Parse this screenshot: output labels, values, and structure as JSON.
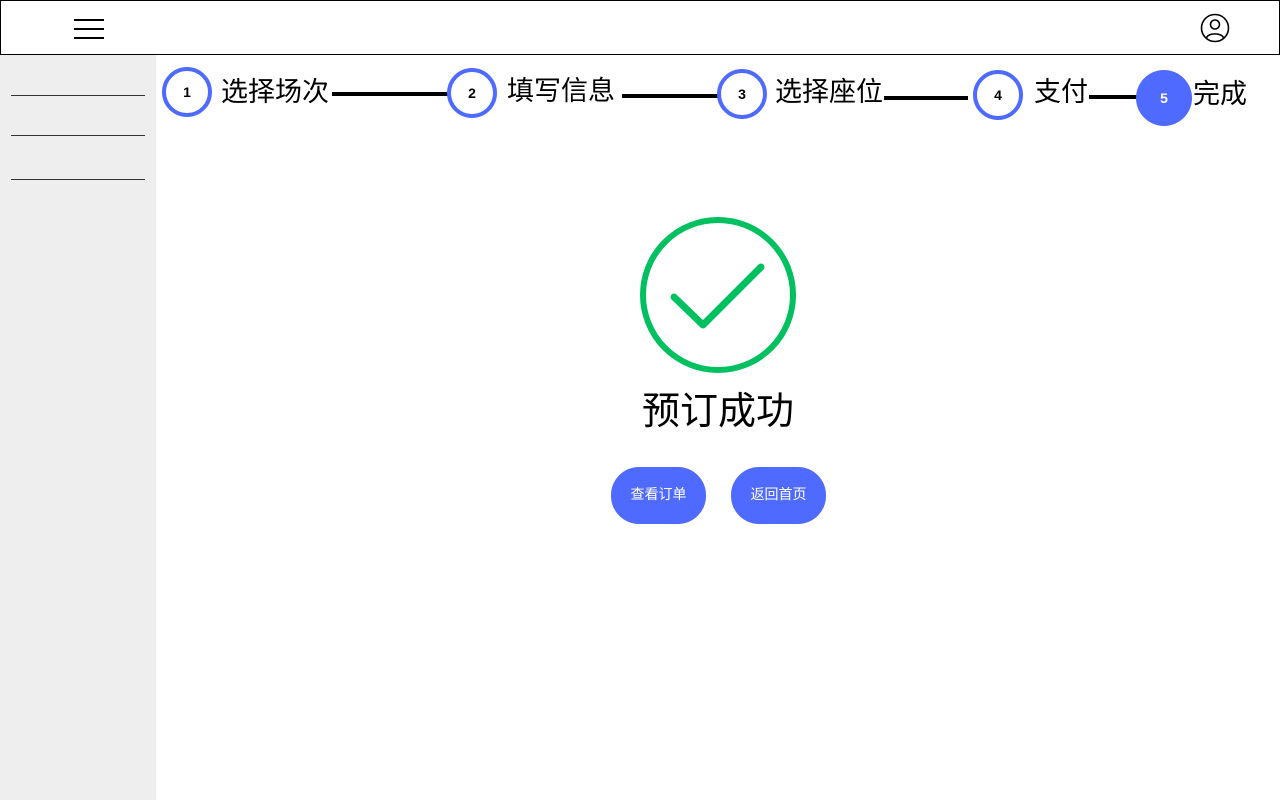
{
  "header": {
    "menu_icon": "hamburger-menu-icon",
    "user_icon": "user-avatar-icon"
  },
  "steps": [
    {
      "number": "1",
      "label": "选择场次",
      "state": "done"
    },
    {
      "number": "2",
      "label": "填写信息",
      "state": "done"
    },
    {
      "number": "3",
      "label": "选择座位",
      "state": "done"
    },
    {
      "number": "4",
      "label": "支付",
      "state": "done"
    },
    {
      "number": "5",
      "label": "完成",
      "state": "current"
    }
  ],
  "result": {
    "icon": "check-circle-icon",
    "title": "预订成功"
  },
  "actions": {
    "view_order": "查看订单",
    "back_home": "返回首页"
  },
  "colors": {
    "accent": "#4f6bff",
    "success": "#00c060",
    "sidebar_bg": "#eeeeee"
  }
}
